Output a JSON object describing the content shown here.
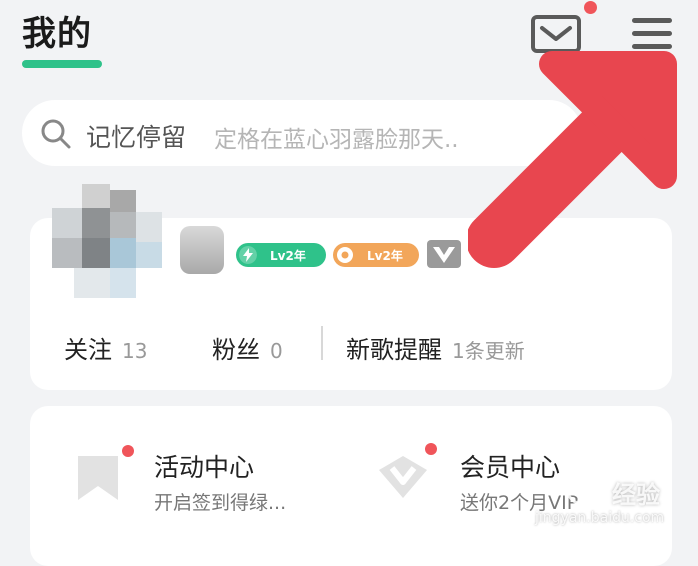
{
  "header": {
    "title": "我的",
    "mail_icon": "mail-icon",
    "menu_icon": "menu-icon"
  },
  "search": {
    "icon": "search-icon",
    "keyword": "记忆停留",
    "placeholder": "定格在蓝心羽露脸那天.."
  },
  "profile": {
    "avatar_icon": "avatar",
    "badges": [
      {
        "icon": "lightning-icon",
        "label": "Lv2年",
        "color": "#2fc28a"
      },
      {
        "icon": "music-disc-icon",
        "label": "Lv2年",
        "color": "#f2a65a"
      },
      {
        "icon": "heart-v-icon"
      }
    ],
    "stats": [
      {
        "label": "关注",
        "value": "13"
      },
      {
        "label": "粉丝",
        "value": "0"
      },
      {
        "label": "新歌提醒",
        "value": "1条更新"
      }
    ]
  },
  "tiles": [
    {
      "icon": "bookmark-icon",
      "title": "活动中心",
      "subtitle": "开启签到得绿..."
    },
    {
      "icon": "diamond-heart-icon",
      "title": "会员中心",
      "subtitle": "送你2个月VIP"
    }
  ],
  "watermark": {
    "brand": "经验",
    "url": "jingyan.baidu.com"
  },
  "colors": {
    "accent_green": "#2fc28a",
    "alert_red": "#f0555a",
    "annotation_arrow": "#e8464f",
    "badge_orange": "#f2a65a"
  }
}
